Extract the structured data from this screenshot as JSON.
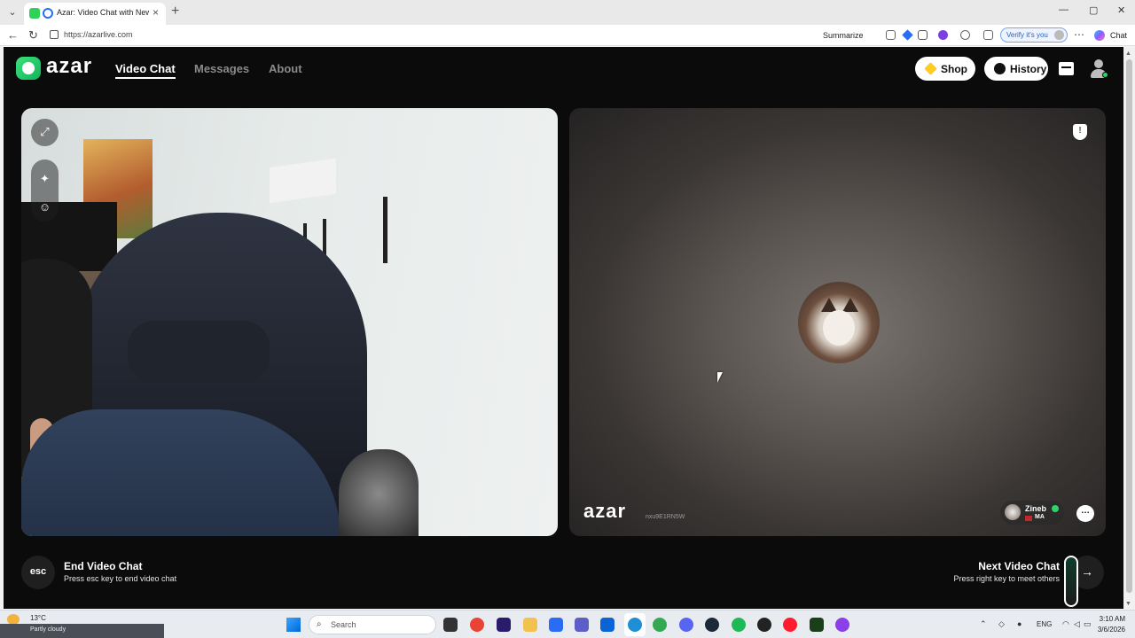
{
  "browser": {
    "tab_title": "Azar: Video Chat with New Pe",
    "tab_close": "×",
    "new_tab": "+",
    "url": "https://azarlive.com",
    "summarize_label": "Summarize",
    "verify_label": "Verify it's you",
    "chat_label": "Chat",
    "window_minimize": "—",
    "window_maximize": "▢",
    "window_close": "✕"
  },
  "app": {
    "brand": "azar",
    "nav": [
      {
        "label": "Video Chat",
        "active": true
      },
      {
        "label": "Messages",
        "active": false
      },
      {
        "label": "About",
        "active": false
      }
    ],
    "shop_label": "Shop",
    "history_label": "History",
    "accent_color": "#2ed36b"
  },
  "remote": {
    "watermark": "azar",
    "session_id": "nxu9E1RN5W",
    "peer_name": "Zineb",
    "peer_country": "MA"
  },
  "controls": {
    "esc_key": "esc",
    "end_title": "End Video Chat",
    "end_subtitle": "Press esc key to end video chat",
    "next_title": "Next Video Chat",
    "next_subtitle": "Press right key to meet others"
  },
  "taskbar": {
    "weather_temp": "13°C",
    "weather_text": "Partly cloudy",
    "search_placeholder": "Search",
    "language": "ENG",
    "time": "3:10 AM",
    "date": "3/6/2026"
  },
  "icons": {
    "local_video": [
      "expand-icon",
      "magic-wand-icon",
      "face-filter-icon"
    ],
    "remote_video": [
      "report-icon",
      "message-icon"
    ],
    "header": [
      "gem-icon",
      "clock-icon",
      "inbox-icon",
      "profile-icon"
    ]
  }
}
